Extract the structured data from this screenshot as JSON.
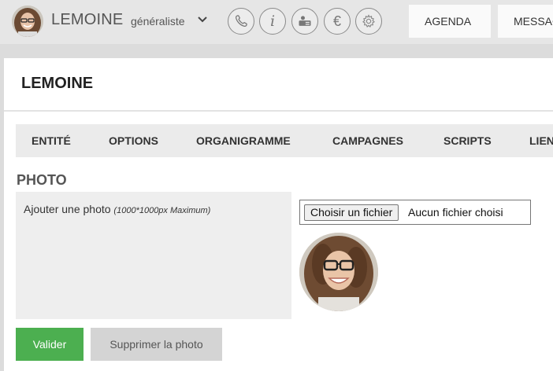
{
  "header": {
    "user_name": "LEMOINE",
    "user_role": "généraliste",
    "icons": [
      "phone-icon",
      "info-icon",
      "contact-card-icon",
      "euro-icon",
      "gear-icon"
    ],
    "info_glyph": "i",
    "euro_glyph": "€",
    "nav": {
      "agenda": "AGENDA",
      "messages": "MESSAGES"
    }
  },
  "page": {
    "title": "LEMOINE"
  },
  "tabs": [
    "ENTITÉ",
    "OPTIONS",
    "ORGANIGRAMME",
    "CAMPAGNES",
    "SCRIPTS",
    "LIENS"
  ],
  "photo_section": {
    "title": "PHOTO",
    "upload_label": "Ajouter une photo",
    "upload_hint": "(1000*1000px Maximum)",
    "file_button": "Choisir un fichier",
    "file_status": "Aucun fichier choisi"
  },
  "actions": {
    "validate": "Valider",
    "delete_photo": "Supprimer la photo"
  },
  "colors": {
    "primary_button": "#4caf50",
    "secondary_button": "#d4d4d4",
    "topbar": "#e6e6e6"
  }
}
